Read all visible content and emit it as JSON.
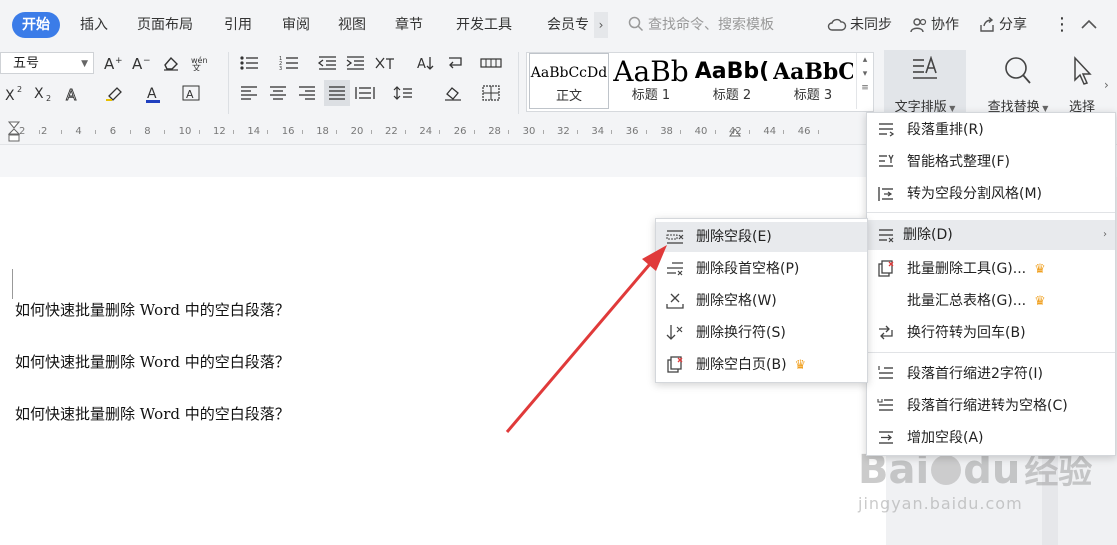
{
  "tabs": [
    {
      "label": "开始",
      "active": true
    },
    {
      "label": "插入"
    },
    {
      "label": "页面布局"
    },
    {
      "label": "引用"
    },
    {
      "label": "审阅"
    },
    {
      "label": "视图"
    },
    {
      "label": "章节"
    },
    {
      "label": "开发工具"
    },
    {
      "label": "会员专"
    }
  ],
  "tab_more": "›",
  "search": {
    "placeholder": "查找命令、搜索模板"
  },
  "top_actions": {
    "sync": "未同步",
    "collab": "协作",
    "share": "分享"
  },
  "ribbon": {
    "font_size": "五号",
    "styles": [
      {
        "sample": "AaBbCcDd",
        "label": "正文"
      },
      {
        "sample": "AaBb",
        "label": "标题 1"
      },
      {
        "sample": "AaBb(",
        "label": "标题 2"
      },
      {
        "sample": "AaBbC",
        "label": "标题 3"
      }
    ],
    "text_layout": "文字排版",
    "find_replace": "查找替换",
    "select": "选择"
  },
  "ruler_numbers": [
    "2",
    "2",
    "4",
    "6",
    "8",
    "10",
    "12",
    "14",
    "16",
    "18",
    "20",
    "22",
    "24",
    "26",
    "28",
    "30",
    "32",
    "34",
    "36",
    "38",
    "40",
    "42",
    "44",
    "46"
  ],
  "document": {
    "lines": [
      "如何快速批量删除 Word 中的空白段落？",
      "如何快速批量删除 Word 中的空白段落？",
      "如何快速批量删除 Word 中的空白段落？"
    ]
  },
  "text_layout_menu": [
    {
      "label": "段落重排(R)",
      "icon": "paragraph-rearrange-icon"
    },
    {
      "label": "智能格式整理(F)",
      "icon": "smart-format-icon"
    },
    {
      "label": "转为空段分割风格(M)",
      "icon": "split-style-icon"
    },
    {
      "label": "删除(D)",
      "icon": "delete-lines-icon",
      "submenu": true,
      "highlighted": true
    },
    {
      "label": "批量删除工具(G)...",
      "icon": "batch-delete-icon",
      "premium": true
    },
    {
      "label": "批量汇总表格(G)...",
      "icon": "",
      "premium": true
    },
    {
      "label": "换行符转为回车(B)",
      "icon": "linebreak-convert-icon"
    },
    {
      "label": "段落首行缩进2字符(I)",
      "icon": "indent-icon"
    },
    {
      "label": "段落首行缩进转为空格(C)",
      "icon": "indent-space-icon"
    },
    {
      "label": "增加空段(A)",
      "icon": "add-paragraph-icon"
    }
  ],
  "delete_submenu": [
    {
      "label": "删除空段(E)",
      "icon": "delete-empty-paragraph-icon",
      "highlighted": true
    },
    {
      "label": "删除段首空格(P)",
      "icon": "delete-leading-space-icon"
    },
    {
      "label": "删除空格(W)",
      "icon": "delete-space-icon"
    },
    {
      "label": "删除换行符(S)",
      "icon": "delete-linebreak-icon"
    },
    {
      "label": "删除空白页(B)",
      "icon": "delete-blank-page-icon",
      "premium": true
    }
  ],
  "crown_glyph": "♛",
  "submenu_arrow": "›",
  "watermark": {
    "main": "Bai",
    "paw": "du",
    "cn": "经验",
    "url": "jingyan.baidu.com"
  },
  "colors": {
    "accent": "#3b7ce8",
    "arrow": "#e03a3a",
    "crown": "#f0a020",
    "scrollbar": "#38c16a"
  }
}
